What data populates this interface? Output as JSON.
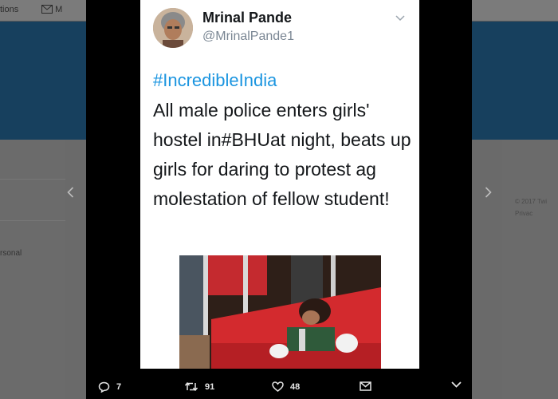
{
  "background": {
    "nav_left": "tions",
    "nav_messages": "M",
    "left_text": "rsonal",
    "right_copyright": "© 2017 Twi",
    "right_privacy": "Privac"
  },
  "tweet": {
    "author_name": "Mrinal Pande",
    "author_handle": "@MrinalPande1",
    "hashtag": "#IncredibleIndia",
    "text": "All male police enters girls' hostel in#BHUat night, beats up girls for daring to protest ag molestation of fellow student!"
  },
  "actions": {
    "replies": "7",
    "retweets": "91",
    "likes": "48"
  },
  "colors": {
    "link": "#1b95e0",
    "lightbox": "#000000",
    "background_header": "#17405e"
  },
  "icons": [
    "chevron-left-icon",
    "chevron-right-icon",
    "caret-down-icon",
    "reply-icon",
    "retweet-icon",
    "heart-icon",
    "direct-message-icon",
    "chevron-down-icon",
    "mail-icon"
  ]
}
